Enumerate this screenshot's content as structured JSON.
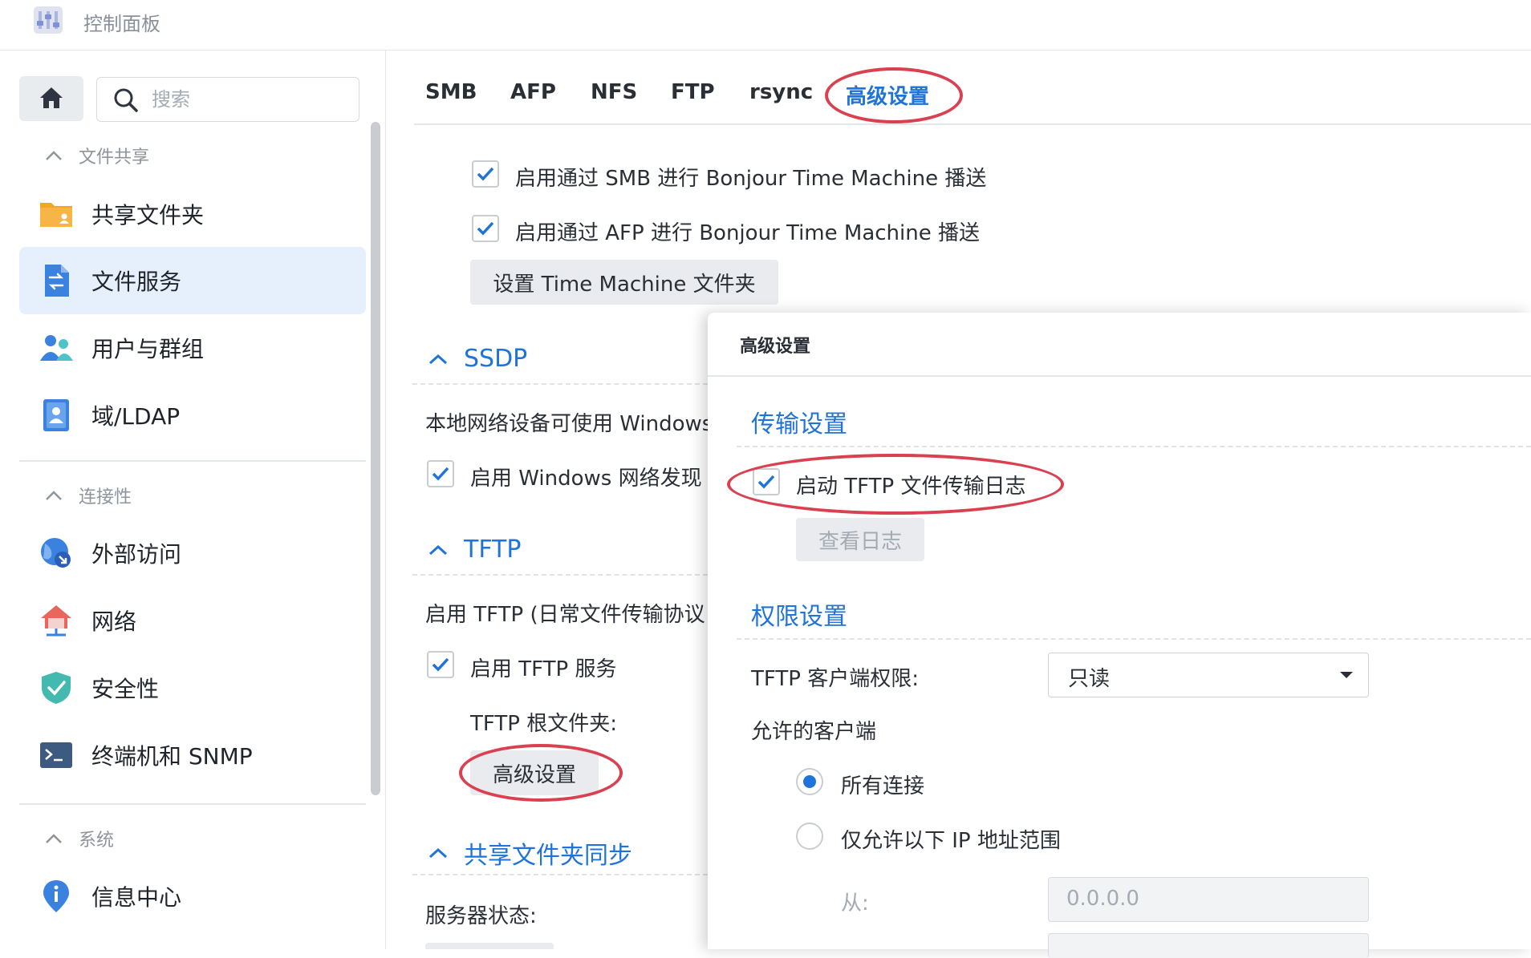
{
  "window": {
    "title": "控制面板"
  },
  "sidebar": {
    "search_placeholder": "搜索",
    "sections": [
      {
        "title": "文件共享"
      },
      {
        "title": "连接性"
      },
      {
        "title": "系统"
      }
    ],
    "items": [
      {
        "label": "共享文件夹",
        "icon": "folder-icon"
      },
      {
        "label": "文件服务",
        "icon": "file-services-icon",
        "active": true
      },
      {
        "label": "用户与群组",
        "icon": "users-icon"
      },
      {
        "label": "域/LDAP",
        "icon": "directory-icon"
      },
      {
        "label": "外部访问",
        "icon": "globe-icon"
      },
      {
        "label": "网络",
        "icon": "network-house-icon"
      },
      {
        "label": "安全性",
        "icon": "shield-icon"
      },
      {
        "label": "终端机和 SNMP",
        "icon": "terminal-icon"
      },
      {
        "label": "信息中心",
        "icon": "info-icon"
      }
    ]
  },
  "tabs": [
    "SMB",
    "AFP",
    "NFS",
    "FTP",
    "rsync",
    "高级设置"
  ],
  "main": {
    "tm_smb": "启用通过 SMB 进行 Bonjour Time Machine 播送",
    "tm_afp": "启用通过 AFP 进行 Bonjour Time Machine 播送",
    "tm_button": "设置 Time Machine 文件夹",
    "ssdp": {
      "title": "SSDP",
      "desc": "本地网络设备可使用 Windows",
      "checkbox": "启用 Windows 网络发现"
    },
    "tftp": {
      "title": "TFTP",
      "desc": "启用 TFTP (日常文件传输协议",
      "checkbox": "启用 TFTP 服务",
      "root_label": "TFTP 根文件夹:",
      "advanced_button": "高级设置"
    },
    "sync": {
      "title": "共享文件夹同步",
      "status_label": "服务器状态:"
    }
  },
  "dialog": {
    "title": "高级设置",
    "transfer": {
      "title": "传输设置",
      "log_checkbox": "启动 TFTP 文件传输日志",
      "view_log_button": "查看日志"
    },
    "permission": {
      "title": "权限设置",
      "client_perm_label": "TFTP 客户端权限:",
      "client_perm_value": "只读",
      "allowed_label": "允许的客户端",
      "radio_all": "所有连接",
      "radio_range": "仅允许以下 IP 地址范围",
      "from_label": "从:",
      "from_value": "0.0.0.0"
    }
  },
  "colors": {
    "accent": "#1f73d9",
    "highlight_ellipse": "#d94150",
    "active_bg": "#e6f0fd"
  }
}
